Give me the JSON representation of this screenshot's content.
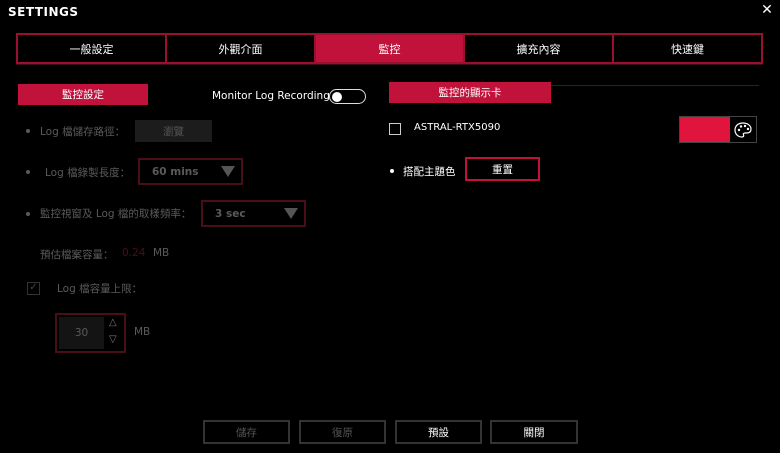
{
  "window": {
    "title": "SETTINGS",
    "close_glyph": "✕"
  },
  "tabs": [
    {
      "label": "一般設定",
      "active": false
    },
    {
      "label": "外觀介面",
      "active": false
    },
    {
      "label": "監控",
      "active": true
    },
    {
      "label": "擴充內容",
      "active": false
    },
    {
      "label": "快速鍵",
      "active": false
    }
  ],
  "monitor": {
    "header": "監控設定",
    "recording_label": "Monitor Log Recording",
    "recording_on": false,
    "log_path_label": "Log 檔儲存路徑：",
    "browse_label": "瀏覽",
    "log_length_label": "Log 檔錄製長度：",
    "log_length_value": "60 mins",
    "sample_label": "監控視窗及 Log 檔的取樣頻率：",
    "sample_value": "3 sec",
    "estimate_label": "預估檔案容量：",
    "estimate_value": "0.24",
    "estimate_unit": "MB",
    "limit_label": "Log 檔容量上限：",
    "limit_checked": true,
    "limit_value": "30",
    "limit_unit": "MB"
  },
  "gpu": {
    "header": "監控的顯示卡",
    "card_name": "ASTRAL-RTX5090",
    "card_checked": false,
    "card_color": "#e0143c",
    "theme_label": "搭配主題色",
    "reset_label": "重置"
  },
  "footer": {
    "save": "儲存",
    "restore": "復原",
    "default": "預設",
    "close": "關閉"
  },
  "colors": {
    "accent": "#c0123a",
    "border_dim": "#4a0e19",
    "text_dim": "#5a5a5a"
  }
}
